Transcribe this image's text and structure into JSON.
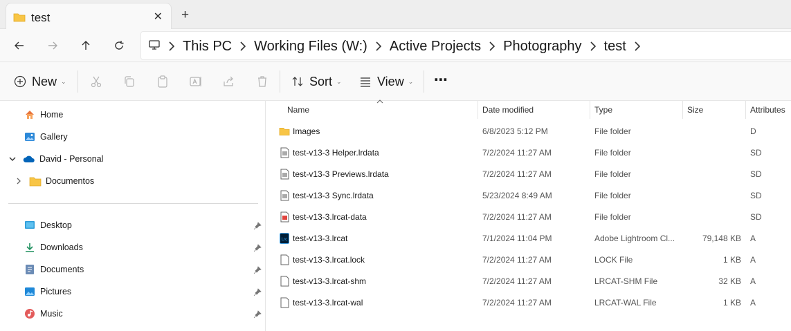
{
  "tab": {
    "title": "test",
    "close_glyph": "✕",
    "new_glyph": "+"
  },
  "breadcrumb": [
    "This PC",
    "Working Files (W:)",
    "Active Projects",
    "Photography",
    "test"
  ],
  "toolbar": {
    "new_label": "New",
    "sort_label": "Sort",
    "view_label": "View",
    "more_glyph": "⋯"
  },
  "navpane": {
    "quick": [
      {
        "label": "Home",
        "icon": "home-icon"
      },
      {
        "label": "Gallery",
        "icon": "gallery-icon"
      },
      {
        "label": "David - Personal",
        "icon": "cloud-icon",
        "expanded": true
      },
      {
        "label": "Documentos",
        "icon": "folder-icon"
      }
    ],
    "pinned": [
      {
        "label": "Desktop",
        "icon": "desktop-icon"
      },
      {
        "label": "Downloads",
        "icon": "download-icon"
      },
      {
        "label": "Documents",
        "icon": "documents-icon"
      },
      {
        "label": "Pictures",
        "icon": "pictures-icon"
      },
      {
        "label": "Music",
        "icon": "music-icon"
      }
    ]
  },
  "columns": {
    "name": "Name",
    "date": "Date modified",
    "type": "Type",
    "size": "Size",
    "attributes": "Attributes"
  },
  "files": [
    {
      "name": "Images",
      "date": "6/8/2023 5:12 PM",
      "type": "File folder",
      "size": "",
      "attr": "D",
      "icon": "folder-icon"
    },
    {
      "name": "test-v13-3 Helper.lrdata",
      "date": "7/2/2024 11:27 AM",
      "type": "File folder",
      "size": "",
      "attr": "SD",
      "icon": "lrdata-icon"
    },
    {
      "name": "test-v13-3 Previews.lrdata",
      "date": "7/2/2024 11:27 AM",
      "type": "File folder",
      "size": "",
      "attr": "SD",
      "icon": "lrdata-icon"
    },
    {
      "name": "test-v13-3 Sync.lrdata",
      "date": "5/23/2024 8:49 AM",
      "type": "File folder",
      "size": "",
      "attr": "SD",
      "icon": "lrdata-icon"
    },
    {
      "name": "test-v13-3.lrcat-data",
      "date": "7/2/2024 11:27 AM",
      "type": "File folder",
      "size": "",
      "attr": "SD",
      "icon": "lrcat-data-icon"
    },
    {
      "name": "test-v13-3.lrcat",
      "date": "7/1/2024 11:04 PM",
      "type": "Adobe Lightroom Cl...",
      "size": "79,148 KB",
      "attr": "A",
      "icon": "lightroom-catalog-icon"
    },
    {
      "name": "test-v13-3.lrcat.lock",
      "date": "7/2/2024 11:27 AM",
      "type": "LOCK File",
      "size": "1 KB",
      "attr": "A",
      "icon": "file-icon"
    },
    {
      "name": "test-v13-3.lrcat-shm",
      "date": "7/2/2024 11:27 AM",
      "type": "LRCAT-SHM File",
      "size": "32 KB",
      "attr": "A",
      "icon": "file-icon"
    },
    {
      "name": "test-v13-3.lrcat-wal",
      "date": "7/2/2024 11:27 AM",
      "type": "LRCAT-WAL File",
      "size": "1 KB",
      "attr": "A",
      "icon": "file-icon"
    }
  ],
  "colors": {
    "folder": "#f8c546",
    "accent": "#0067c0",
    "lightroom": "#001e36",
    "lightroom_text": "#31a8ff"
  }
}
